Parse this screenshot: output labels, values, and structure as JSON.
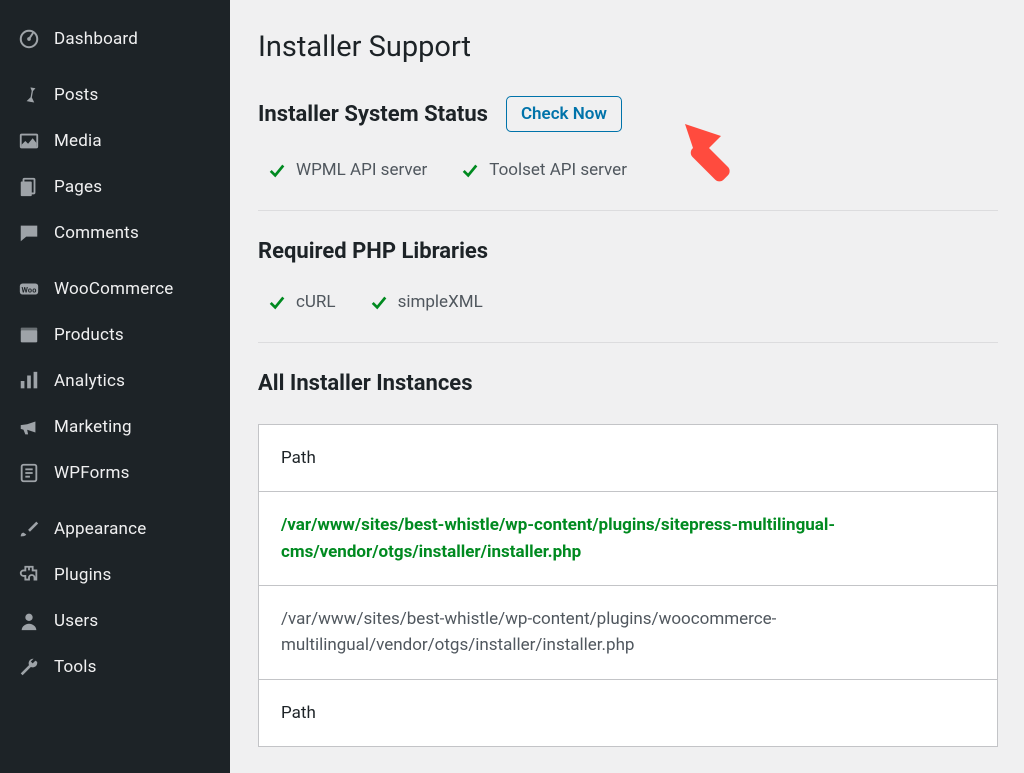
{
  "sidebar": {
    "items": [
      {
        "label": "Dashboard"
      },
      {
        "label": "Posts"
      },
      {
        "label": "Media"
      },
      {
        "label": "Pages"
      },
      {
        "label": "Comments"
      },
      {
        "label": "WooCommerce"
      },
      {
        "label": "Products"
      },
      {
        "label": "Analytics"
      },
      {
        "label": "Marketing"
      },
      {
        "label": "WPForms"
      },
      {
        "label": "Appearance"
      },
      {
        "label": "Plugins"
      },
      {
        "label": "Users"
      },
      {
        "label": "Tools"
      }
    ]
  },
  "page": {
    "title": "Installer Support",
    "system_status": {
      "heading": "Installer System Status",
      "check_button": "Check Now",
      "servers": [
        "WPML API server",
        "Toolset API server"
      ]
    },
    "php_libs": {
      "heading": "Required PHP Libraries",
      "items": [
        "cURL",
        "simpleXML"
      ]
    },
    "instances": {
      "heading": "All Installer Instances",
      "column_header": "Path",
      "rows": [
        "/var/www/sites/best-whistle/wp-content/plugins/sitepress-multilingual-cms/vendor/otgs/installer/installer.php",
        "/var/www/sites/best-whistle/wp-content/plugins/woocommerce-multilingual/vendor/otgs/installer/installer.php"
      ],
      "second_header": "Path"
    }
  }
}
